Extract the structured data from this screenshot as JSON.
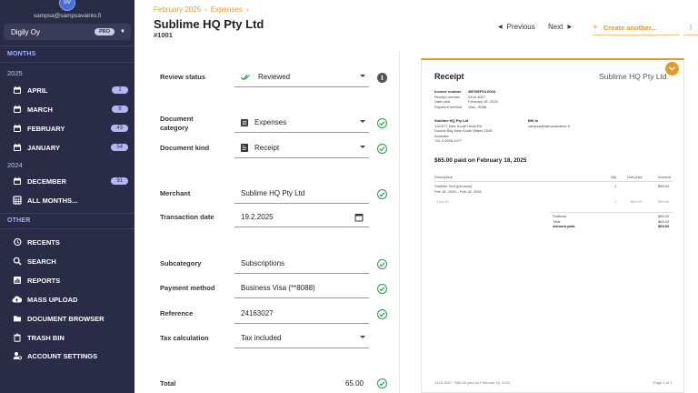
{
  "user": {
    "initials": "SV",
    "email": "sampsa@sampsavainio.fi"
  },
  "org": {
    "name": "Digily Oy",
    "badge": "PRO"
  },
  "sidebar": {
    "months_title": "MONTHS",
    "other_title": "OTHER",
    "year_2025": "2025",
    "year_2024": "2024",
    "months": [
      {
        "label": "APRIL",
        "count": "1"
      },
      {
        "label": "MARCH",
        "count": "6"
      },
      {
        "label": "FEBRUARY",
        "count": "43"
      },
      {
        "label": "JANUARY",
        "count": "54"
      },
      {
        "label": "DECEMBER",
        "count": "91"
      },
      {
        "label": "ALL MONTHS...",
        "count": ""
      }
    ],
    "other": [
      {
        "label": "RECENTS",
        "icon": "history-icon"
      },
      {
        "label": "SEARCH",
        "icon": "search-icon"
      },
      {
        "label": "REPORTS",
        "icon": "chart-icon"
      },
      {
        "label": "MASS UPLOAD",
        "icon": "cloud-upload-icon"
      },
      {
        "label": "DOCUMENT BROWSER",
        "icon": "folder-icon"
      },
      {
        "label": "TRASH BIN",
        "icon": "trash-icon"
      },
      {
        "label": "ACCOUNT SETTINGS",
        "icon": "user-settings-icon"
      }
    ]
  },
  "header": {
    "breadcrumb": [
      "February 2025",
      "Expenses"
    ],
    "title": "Sublime HQ Pty Ltd",
    "doc_number": "#1001",
    "previous": "Previous",
    "next": "Next",
    "create_another": "Create another..."
  },
  "form": {
    "review_status": {
      "label": "Review status",
      "value": "Reviewed"
    },
    "document_category": {
      "label": "Document category",
      "value": "Expenses"
    },
    "document_kind": {
      "label": "Document kind",
      "value": "Receipt"
    },
    "merchant": {
      "label": "Merchant",
      "value": "Sublime HQ Pty Ltd"
    },
    "transaction_date": {
      "label": "Transaction date",
      "value": "19.2.2025"
    },
    "subcategory": {
      "label": "Subcategory",
      "value": "Subscriptions"
    },
    "payment_method": {
      "label": "Payment method",
      "value": "Business Visa (**8088)"
    },
    "reference": {
      "label": "Reference",
      "value": "24163027"
    },
    "tax_calculation": {
      "label": "Tax calculation",
      "value": "Tax included"
    },
    "total": {
      "label": "Total",
      "value": "65.00"
    }
  },
  "receipt": {
    "title": "Receipt",
    "company": "Sublime HQ Pty Ltd",
    "meta": [
      {
        "k": "Invoice number",
        "v": "4B7DEF04-0004"
      },
      {
        "k": "Receipt number",
        "v": "2416-3027"
      },
      {
        "k": "Date paid",
        "v": "February 18, 2025"
      },
      {
        "k": "Payment method",
        "v": "Visa - 8088"
      }
    ],
    "from": [
      "Sublime HQ Pty Ltd",
      "132/377 New South Head Rd",
      "Double Bay New South Wales 2028",
      "Australia",
      "+61 2 9028 2077"
    ],
    "bill_to": [
      "Bill to",
      "sampsa@sampsavainio.fi"
    ],
    "paid_line": "$65.00 paid on February 18, 2025",
    "table_head": {
      "desc": "Description",
      "qty": "Qty",
      "unit": "Unit price",
      "amount": "Amount"
    },
    "item": {
      "desc": "Sublime Text (per seat)",
      "period": "Feb 18, 2025 – Feb 18, 2026",
      "qty": "1",
      "amount": "$65.00"
    },
    "subitem": {
      "desc": "First ID",
      "qty": "1",
      "unit": "$65.00",
      "amount": "$65.00"
    },
    "summary": [
      {
        "k": "Subtotal",
        "v": "$65.00"
      },
      {
        "k": "Total",
        "v": "$65.00"
      },
      {
        "k": "Amount paid",
        "v": "$65.00"
      }
    ],
    "footer_left": "2416-3027 · $65.00 paid on February 18, 2025",
    "footer_right": "Page 1 of 1"
  },
  "colors": {
    "sidebar": "#2a2b47",
    "accent": "#e39a2e",
    "check": "#2e9a47",
    "badge": "#b9b5f5"
  }
}
